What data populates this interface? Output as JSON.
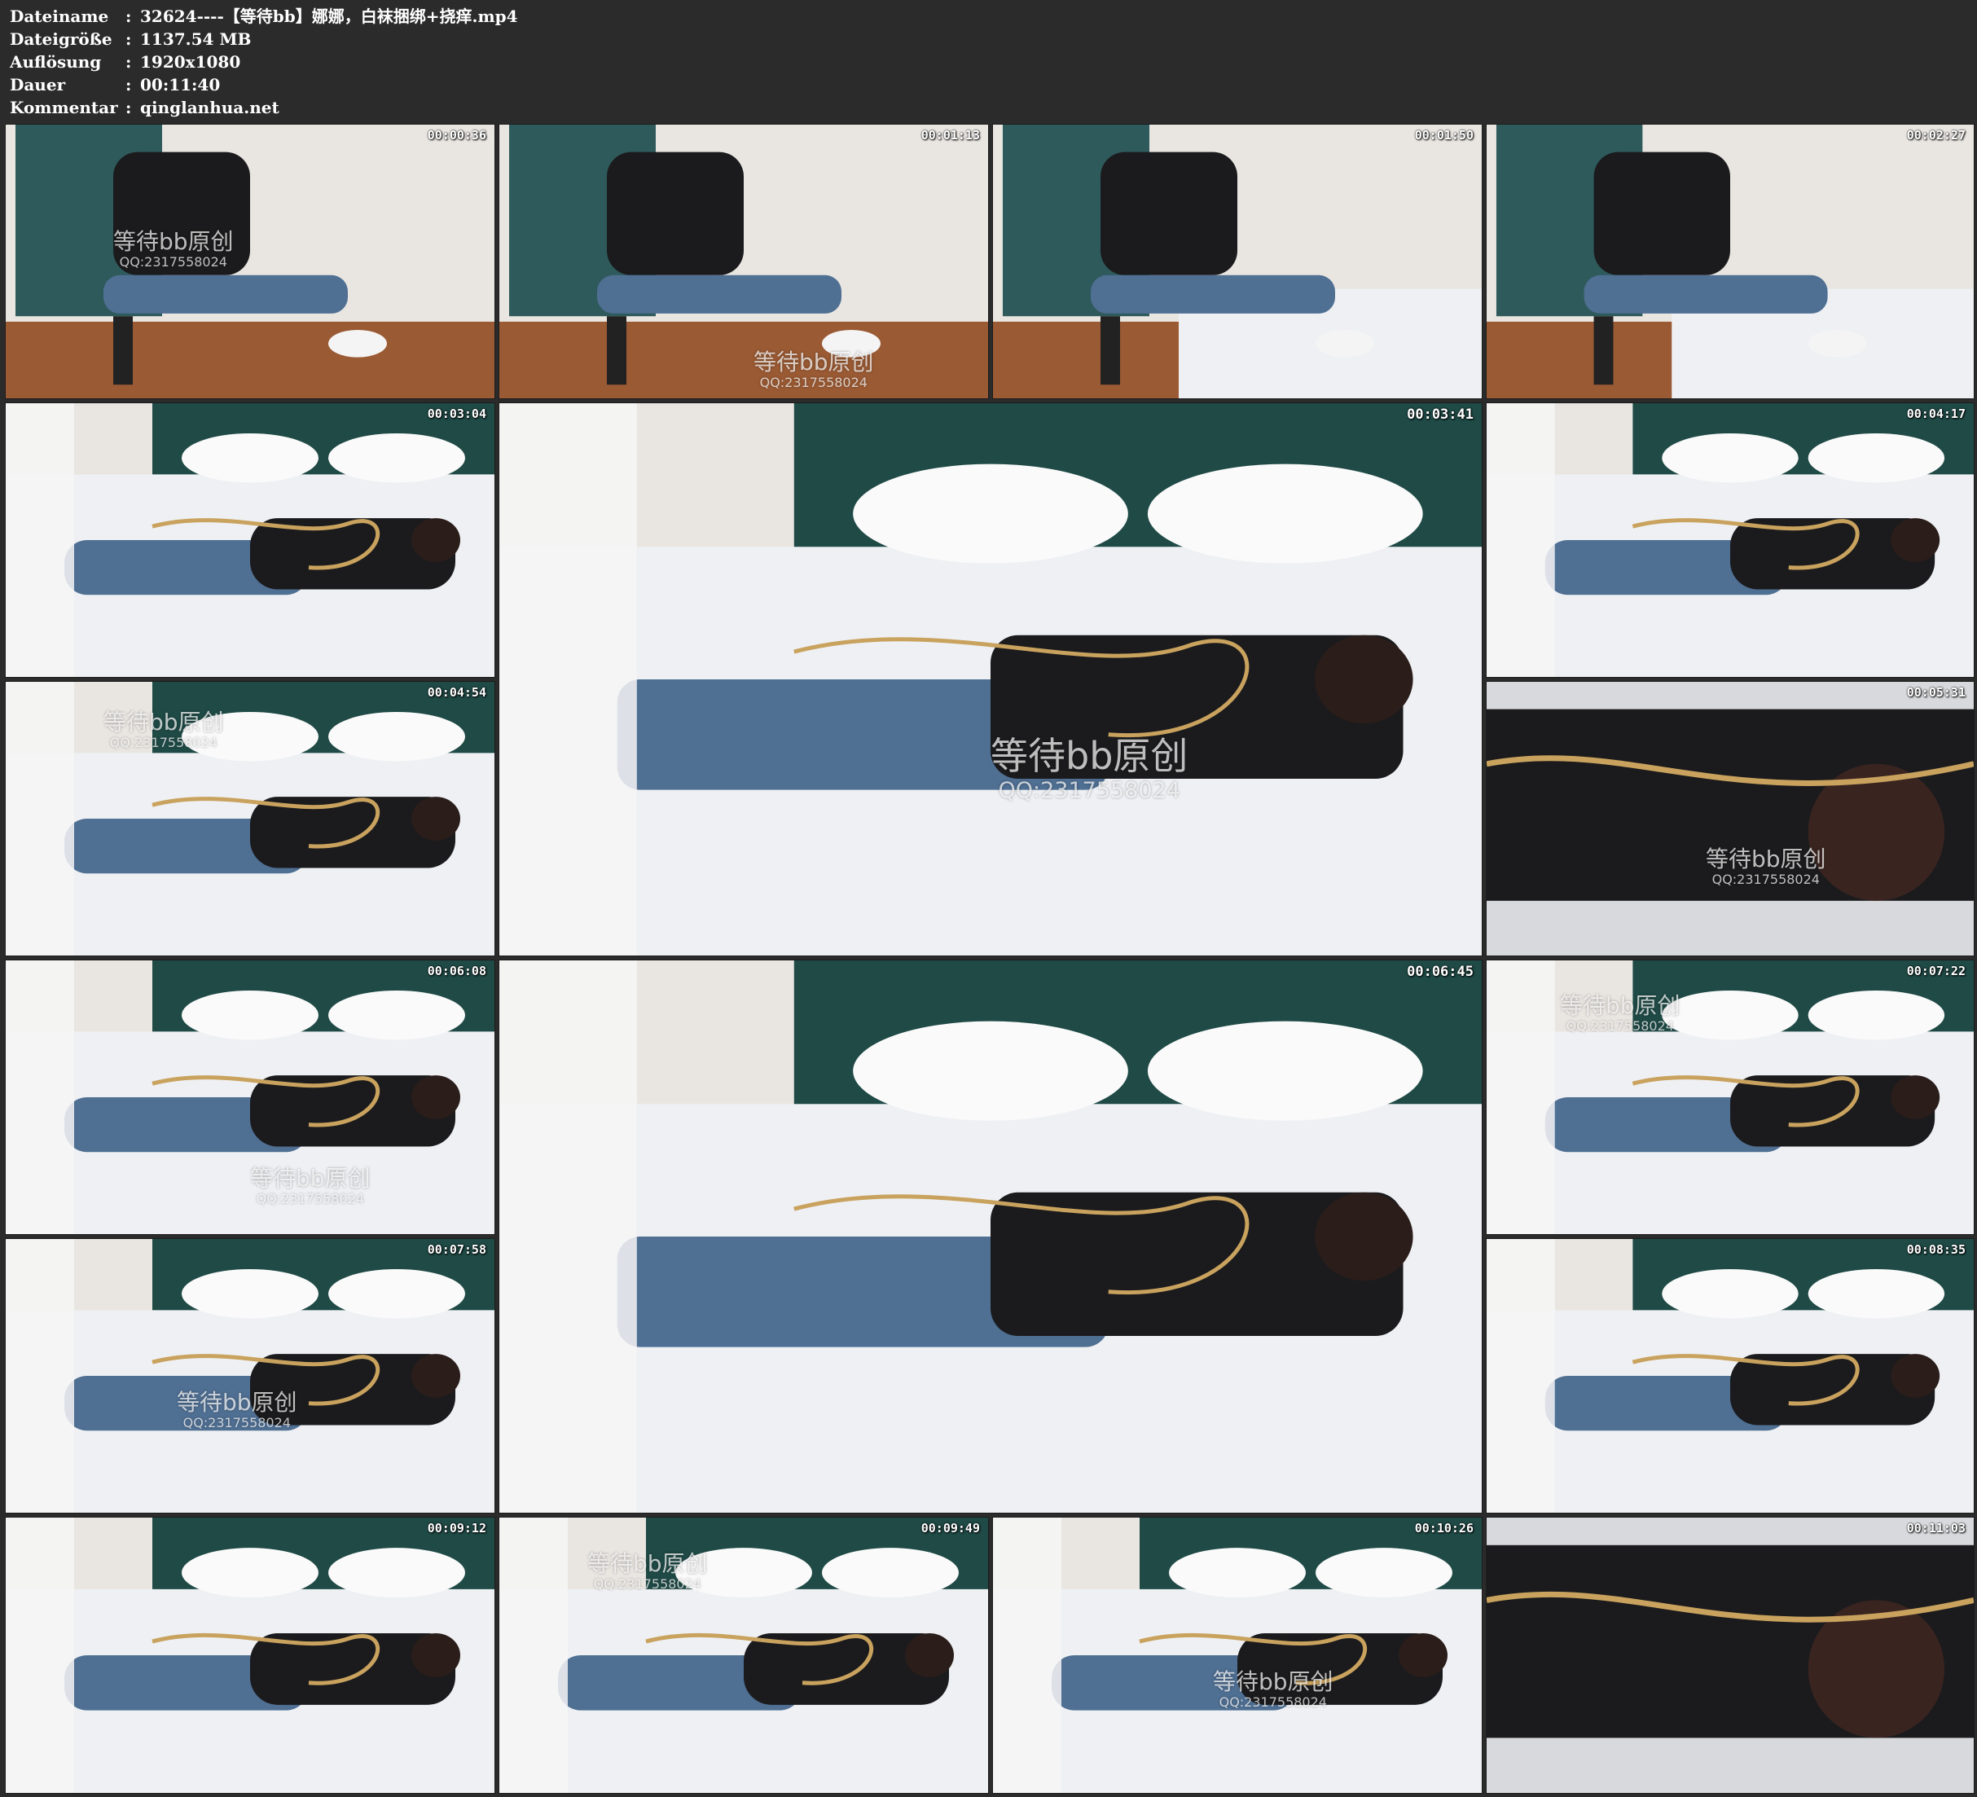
{
  "file_info": {
    "name_label": "Dateiname",
    "name_value": "32624----【等待bb】娜娜，白袜捆绑+挠痒.mp4",
    "size_label": "Dateigröße",
    "size_value": "1137.54 MB",
    "resolution_label": "Auflösung",
    "resolution_value": "1920x1080",
    "duration_label": "Dauer",
    "duration_value": "00:11:40",
    "comment_label": "Kommentar",
    "comment_value": "qinglanhua.net",
    "separator": ":"
  },
  "watermark": {
    "main": "等待bb原创",
    "sub": "QQ:2317558024"
  },
  "thumbnails": [
    {
      "time": "00:00:36",
      "scene": "chair"
    },
    {
      "time": "00:01:13",
      "scene": "chair"
    },
    {
      "time": "00:01:50",
      "scene": "chair-bed"
    },
    {
      "time": "00:02:27",
      "scene": "chair-bed"
    },
    {
      "time": "00:03:04",
      "scene": "bed"
    },
    {
      "time": "00:03:41",
      "scene": "bed"
    },
    {
      "time": "00:04:17",
      "scene": "bed"
    },
    {
      "time": "00:04:54",
      "scene": "bed"
    },
    {
      "time": "00:05:31",
      "scene": "close"
    },
    {
      "time": "00:06:08",
      "scene": "bed"
    },
    {
      "time": "00:06:45",
      "scene": "bed"
    },
    {
      "time": "00:07:22",
      "scene": "bed"
    },
    {
      "time": "00:07:58",
      "scene": "bed"
    },
    {
      "time": "00:08:35",
      "scene": "bed"
    },
    {
      "time": "00:09:12",
      "scene": "bed"
    },
    {
      "time": "00:09:49",
      "scene": "bed"
    },
    {
      "time": "00:10:26",
      "scene": "bed"
    },
    {
      "time": "00:11:03",
      "scene": "close"
    }
  ],
  "colors": {
    "background": "#2b2b2b",
    "header_text": "#ffffff",
    "sheet": "#eef0f3",
    "denim": "#4f6f93",
    "black_clothing": "#1b1b1d",
    "rope": "#c9a25e",
    "headboard": "#1f4a46",
    "wall": "#e9e6e1",
    "floor": "#9a5a33",
    "curtain": "#2f5a5c"
  }
}
